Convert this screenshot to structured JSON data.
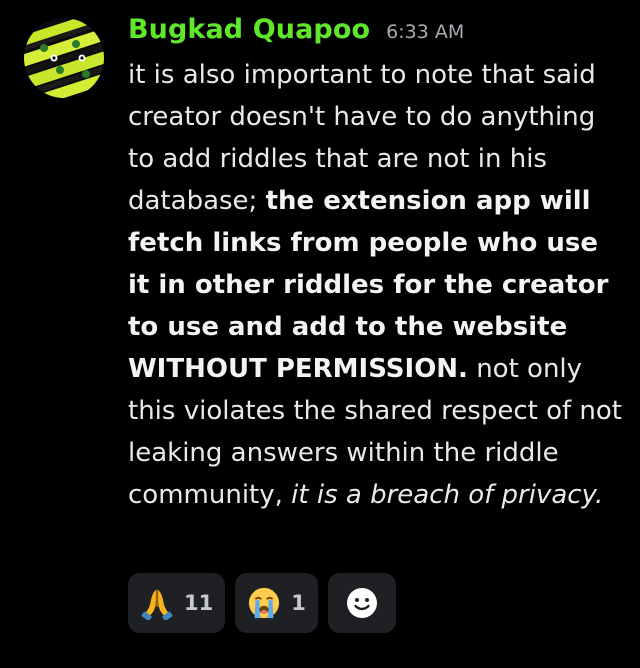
{
  "message": {
    "username": "Bugkad Quapoo",
    "timestamp": "6:33 AM",
    "text": {
      "part1": "it is also important to note that said creator doesn't have to do anything to add riddles that are not in his database; ",
      "part2_bold": "the extension app will fetch links from people who use it in other riddles for the creator to use and add to the website WITHOUT PERMISSION.",
      "part3": " not only this violates the shared respect of not leaking answers within the riddle community, ",
      "part4_italic": "it is a breach of privacy."
    }
  },
  "reactions": [
    {
      "icon": "folded-hands-emoji",
      "count": "11"
    },
    {
      "icon": "loudly-crying-face-emoji",
      "count": "1"
    }
  ],
  "add_reaction": {
    "icon": "smiley-face-icon"
  },
  "colors": {
    "background": "#000000",
    "username": "#5fe82a",
    "timestamp": "#a7aab1",
    "text": "#e8e9eb",
    "reaction_bg": "#1f2023"
  }
}
